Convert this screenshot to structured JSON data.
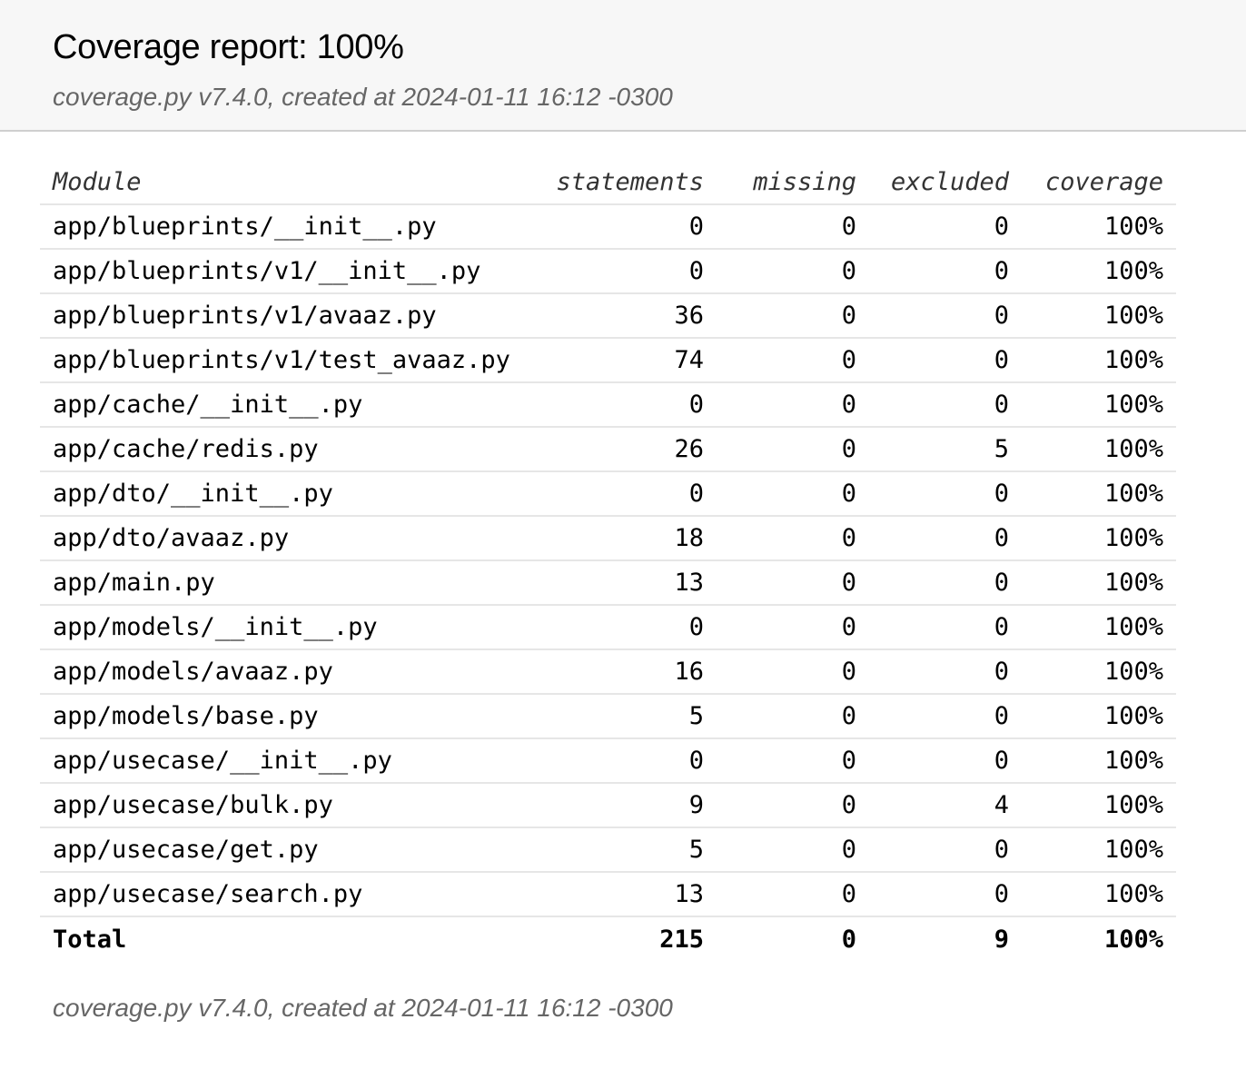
{
  "header": {
    "title": "Coverage report: 100%",
    "meta": "coverage.py v7.4.0, created at 2024-01-11 16:12 -0300"
  },
  "table": {
    "columns": {
      "module": "Module",
      "statements": "statements",
      "missing": "missing",
      "excluded": "excluded",
      "coverage": "coverage"
    },
    "rows": [
      {
        "module": "app/blueprints/__init__.py",
        "statements": "0",
        "missing": "0",
        "excluded": "0",
        "coverage": "100%"
      },
      {
        "module": "app/blueprints/v1/__init__.py",
        "statements": "0",
        "missing": "0",
        "excluded": "0",
        "coverage": "100%"
      },
      {
        "module": "app/blueprints/v1/avaaz.py",
        "statements": "36",
        "missing": "0",
        "excluded": "0",
        "coverage": "100%"
      },
      {
        "module": "app/blueprints/v1/test_avaaz.py",
        "statements": "74",
        "missing": "0",
        "excluded": "0",
        "coverage": "100%"
      },
      {
        "module": "app/cache/__init__.py",
        "statements": "0",
        "missing": "0",
        "excluded": "0",
        "coverage": "100%"
      },
      {
        "module": "app/cache/redis.py",
        "statements": "26",
        "missing": "0",
        "excluded": "5",
        "coverage": "100%"
      },
      {
        "module": "app/dto/__init__.py",
        "statements": "0",
        "missing": "0",
        "excluded": "0",
        "coverage": "100%"
      },
      {
        "module": "app/dto/avaaz.py",
        "statements": "18",
        "missing": "0",
        "excluded": "0",
        "coverage": "100%"
      },
      {
        "module": "app/main.py",
        "statements": "13",
        "missing": "0",
        "excluded": "0",
        "coverage": "100%"
      },
      {
        "module": "app/models/__init__.py",
        "statements": "0",
        "missing": "0",
        "excluded": "0",
        "coverage": "100%"
      },
      {
        "module": "app/models/avaaz.py",
        "statements": "16",
        "missing": "0",
        "excluded": "0",
        "coverage": "100%"
      },
      {
        "module": "app/models/base.py",
        "statements": "5",
        "missing": "0",
        "excluded": "0",
        "coverage": "100%"
      },
      {
        "module": "app/usecase/__init__.py",
        "statements": "0",
        "missing": "0",
        "excluded": "0",
        "coverage": "100%"
      },
      {
        "module": "app/usecase/bulk.py",
        "statements": "9",
        "missing": "0",
        "excluded": "4",
        "coverage": "100%"
      },
      {
        "module": "app/usecase/get.py",
        "statements": "5",
        "missing": "0",
        "excluded": "0",
        "coverage": "100%"
      },
      {
        "module": "app/usecase/search.py",
        "statements": "13",
        "missing": "0",
        "excluded": "0",
        "coverage": "100%"
      }
    ],
    "total": {
      "module": "Total",
      "statements": "215",
      "missing": "0",
      "excluded": "9",
      "coverage": "100%"
    }
  },
  "footer": {
    "meta": "coverage.py v7.4.0, created at 2024-01-11 16:12 -0300"
  }
}
